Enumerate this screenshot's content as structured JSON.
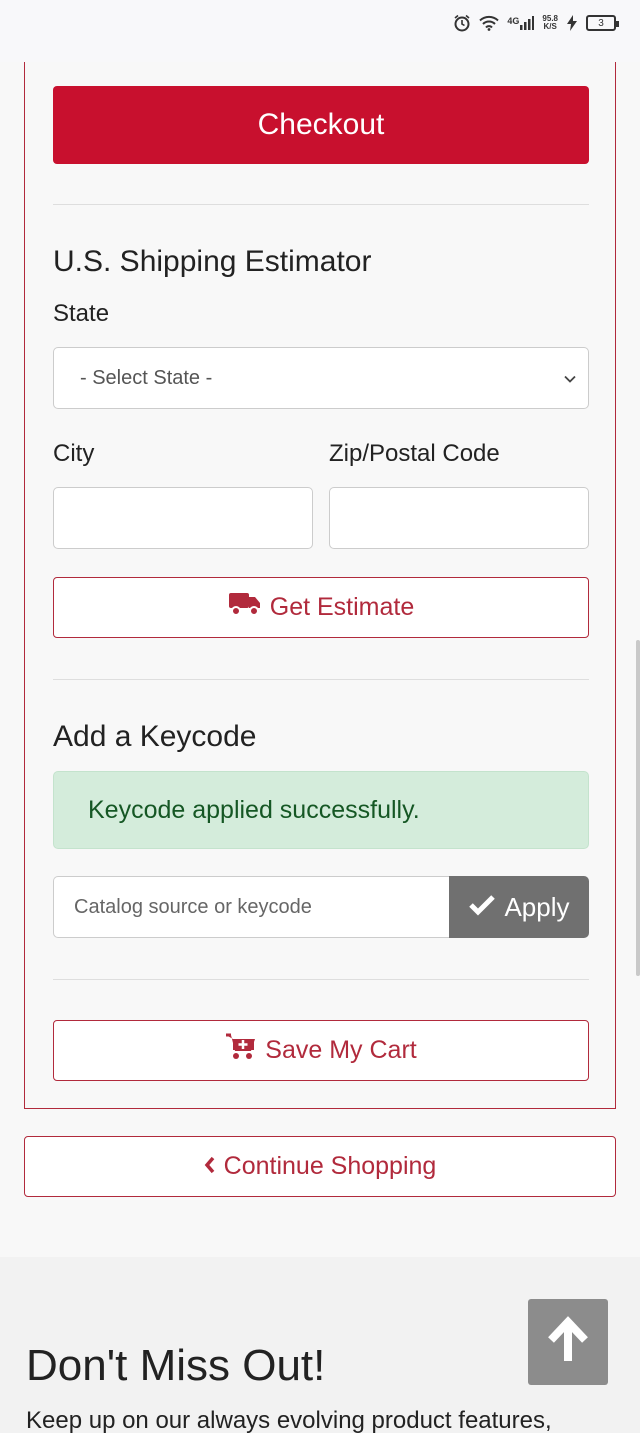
{
  "status_bar": {
    "network": "4G",
    "speed_value": "95.8",
    "speed_unit": "K/S",
    "battery": "3"
  },
  "cart": {
    "checkout_label": "Checkout",
    "shipping": {
      "heading": "U.S. Shipping Estimator",
      "state_label": "State",
      "state_select_value": "- Select State -",
      "city_label": "City",
      "city_value": "",
      "zip_label": "Zip/Postal Code",
      "zip_value": "",
      "estimate_label": "Get Estimate"
    },
    "keycode": {
      "heading": "Add a Keycode",
      "alert": "Keycode applied successfully.",
      "placeholder": "Catalog source or keycode",
      "apply_label": "Apply"
    },
    "save_cart_label": "Save My Cart"
  },
  "continue_label": "Continue Shopping",
  "footer": {
    "title": "Don't Miss Out!",
    "text": "Keep up on our always evolving product features,"
  },
  "colors": {
    "brand_red": "#c8102e",
    "outline_red": "#b12a3c",
    "success_bg": "#d4ecdb",
    "success_text": "#155724",
    "apply_gray": "#707070"
  }
}
